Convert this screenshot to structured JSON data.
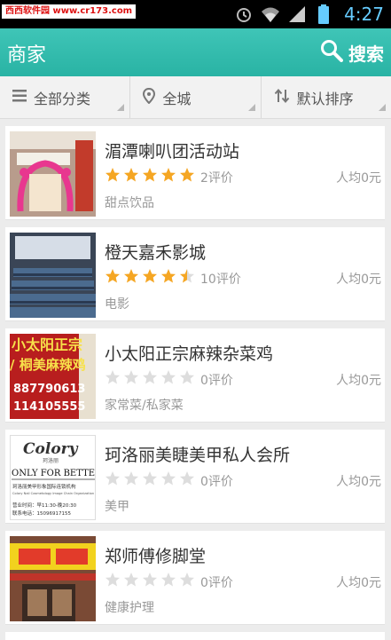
{
  "status_bar": {
    "watermark": "西西软件园 www.cr173.com",
    "time": "4:27",
    "icons": [
      "alarm-icon",
      "wifi-icon",
      "signal-icon",
      "battery-icon"
    ]
  },
  "app_bar": {
    "title": "商家",
    "search_label": "搜索"
  },
  "filters": [
    {
      "label": "全部分类",
      "icon": "list-icon"
    },
    {
      "label": "全城",
      "icon": "location-pin-icon"
    },
    {
      "label": "默认排序",
      "icon": "sort-icon"
    }
  ],
  "merchants": [
    {
      "name": "湄潭喇叭团活动站",
      "rating": 5,
      "reviews": "2评价",
      "avg_price": "人均0元",
      "category": "甜点饮品"
    },
    {
      "name": "橙天嘉禾影城",
      "rating": 4.5,
      "reviews": "10评价",
      "avg_price": "人均0元",
      "category": "电影"
    },
    {
      "name": "小太阳正宗麻辣杂菜鸡",
      "rating": 0,
      "reviews": "0评价",
      "avg_price": "人均0元",
      "category": "家常菜/私家菜"
    },
    {
      "name": "珂洛丽美睫美甲私人会所",
      "rating": 0,
      "reviews": "0评价",
      "avg_price": "人均0元",
      "category": "美甲"
    },
    {
      "name": "郑师傅修脚堂",
      "rating": 0,
      "reviews": "0评价",
      "avg_price": "人均0元",
      "category": "健康护理"
    }
  ],
  "thumb_text": {
    "shop3_line1": "小太阳正宗",
    "shop3_line2": "/ 桐美麻辣鸡",
    "shop3_phone1": "887790613",
    "shop3_phone2": "114105555",
    "shop4_logo": "Colory",
    "shop4_logo_sub": "珂洛丽",
    "shop4_banner": "ONLY FOR BETTER",
    "shop4_line1": "珂洛丽美甲形象国际连锁机构",
    "shop4_line2": "Colory Nail Cosmetology Image Chain Organization",
    "shop4_hours": "营业时间：早11:30-晚20:30",
    "shop4_phone": "联系电话：15096917155"
  },
  "colors": {
    "accent": "#2fbbad",
    "star_on": "#f5a623",
    "star_off": "#dddddd"
  }
}
